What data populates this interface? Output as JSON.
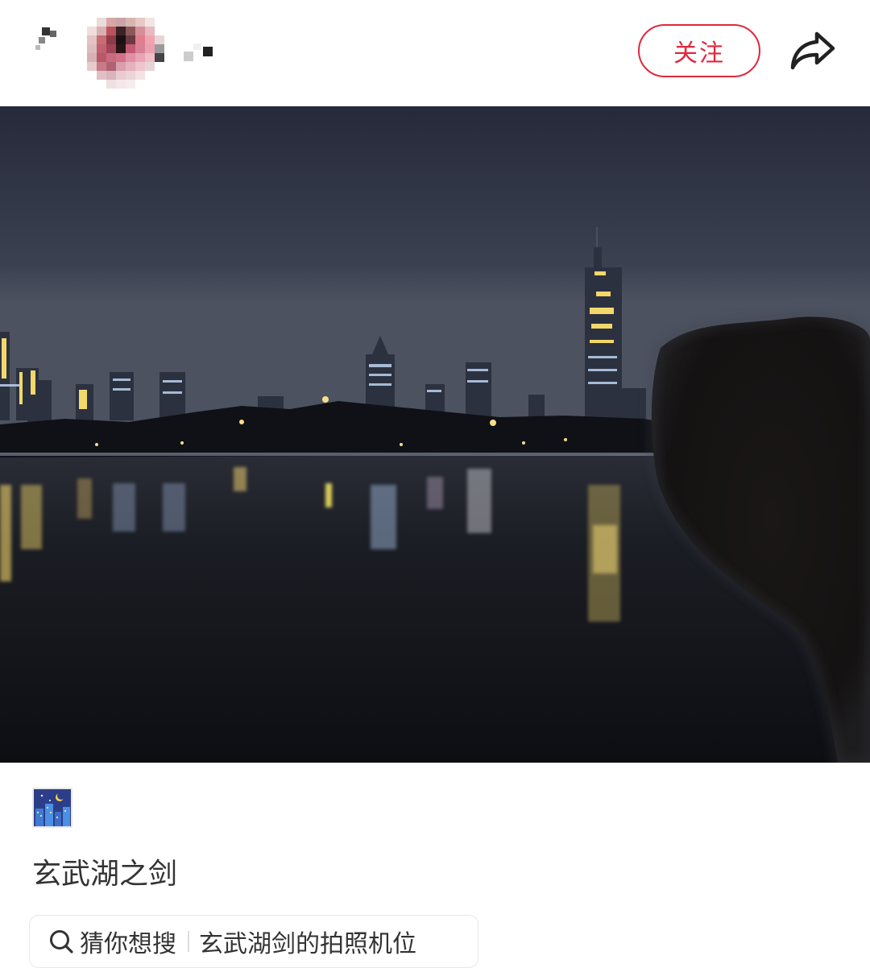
{
  "header": {
    "follow_label": "关注",
    "icons": {
      "back": "back-icon",
      "share": "share-icon"
    }
  },
  "post": {
    "sticker_icon": "night-city-emoji",
    "title": "玄武湖之剑"
  },
  "suggestion": {
    "label": "猜你想搜",
    "query": "玄武湖剑的拍照机位",
    "icon": "search-icon"
  },
  "colors": {
    "accent": "#e0283c",
    "text": "#333333",
    "sky_top": "#2a2e3a",
    "water": "#121418"
  }
}
